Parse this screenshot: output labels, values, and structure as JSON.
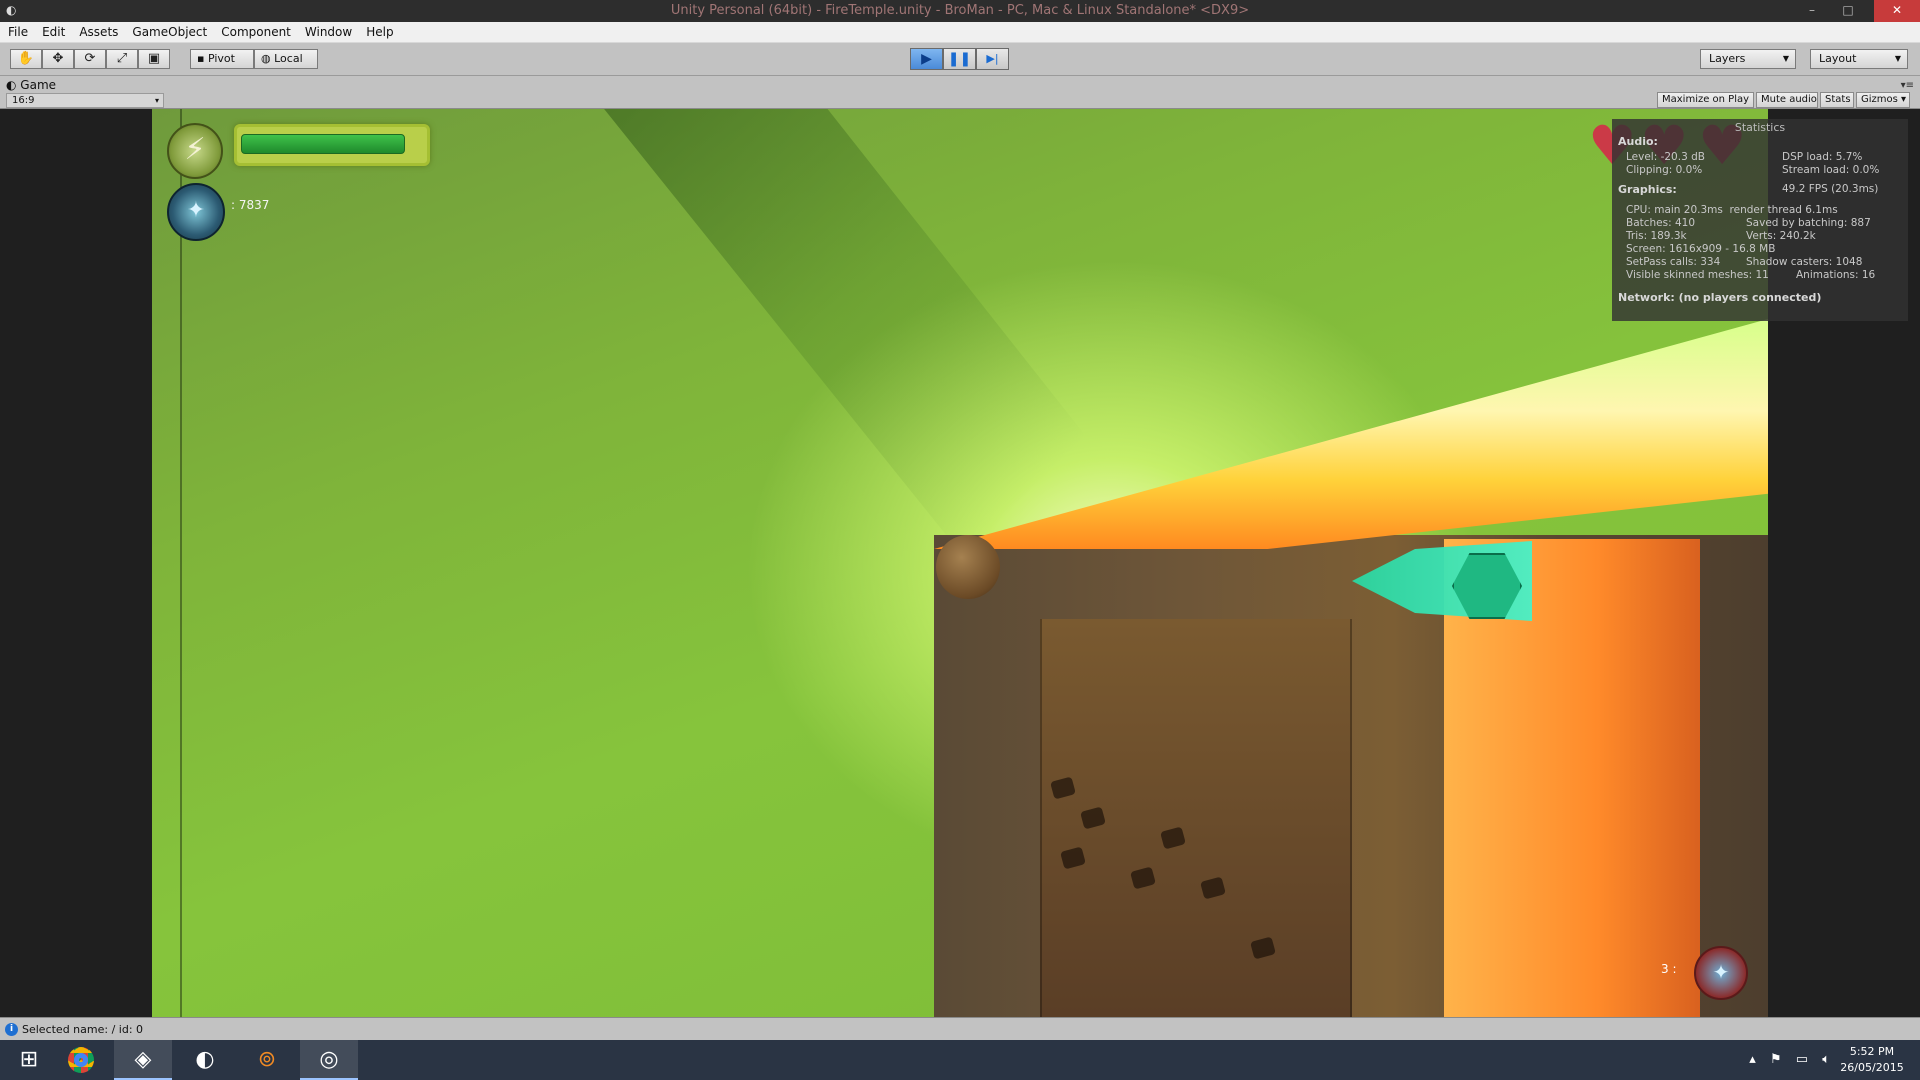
{
  "window": {
    "title": "Unity Personal (64bit) - FireTemple.unity - BroMan - PC, Mac & Linux Standalone* <DX9>",
    "controls": {
      "minimize": "–",
      "maximize": "□",
      "close": "✕"
    }
  },
  "menu": [
    "File",
    "Edit",
    "Assets",
    "GameObject",
    "Component",
    "Window",
    "Help"
  ],
  "toolbar": {
    "tools": [
      {
        "name": "hand-tool",
        "glyph": "✋"
      },
      {
        "name": "move-tool",
        "glyph": "✥"
      },
      {
        "name": "rotate-tool",
        "glyph": "⟳"
      },
      {
        "name": "scale-tool",
        "glyph": "⤢"
      },
      {
        "name": "rect-tool",
        "glyph": "▣"
      }
    ],
    "pivot_label": "Pivot",
    "local_label": "Local",
    "play_glyph": "▶",
    "pause_glyph": "❚❚",
    "step_glyph": "▶|",
    "layers_label": "Layers",
    "layout_label": "Layout"
  },
  "game_view": {
    "tab_label": "Game",
    "aspect": "16:9",
    "buttons": {
      "maximize_on_play": "Maximize on Play",
      "mute_audio": "Mute audio",
      "stats": "Stats",
      "gizmos": "Gizmos"
    }
  },
  "hud": {
    "health_fraction": 0.9,
    "crystal_count": ": 7837",
    "lives_label": "3 :",
    "hearts": 3
  },
  "stats": {
    "title": "Statistics",
    "audio_header": "Audio:",
    "audio_level": "Level: -20.3 dB",
    "audio_clipping": "Clipping: 0.0%",
    "dsp_load": "DSP load: 5.7%",
    "stream_load": "Stream load: 0.0%",
    "graphics_header": "Graphics:",
    "fps": "49.2 FPS (20.3ms)",
    "cpu": "CPU: main 20.3ms  render thread 6.1ms",
    "batches": "Batches: 410",
    "saved_by_batching": "Saved by batching: 887",
    "tris": "Tris: 189.3k",
    "verts": "Verts: 240.2k",
    "screen": "Screen: 1616x909 - 16.8 MB",
    "setpass": "SetPass calls: 334",
    "shadow_casters": "Shadow casters: 1048",
    "skinned": "Visible skinned meshes: 11",
    "animations": "Animations: 16",
    "network": "Network: (no players connected)"
  },
  "statusbar": {
    "message": "Selected name:  / id: 0"
  },
  "taskbar": {
    "apps": [
      "windows-start",
      "chrome",
      "unity",
      "steam",
      "blender",
      "game"
    ],
    "time": "5:52 PM",
    "date": "26/05/2015"
  }
}
